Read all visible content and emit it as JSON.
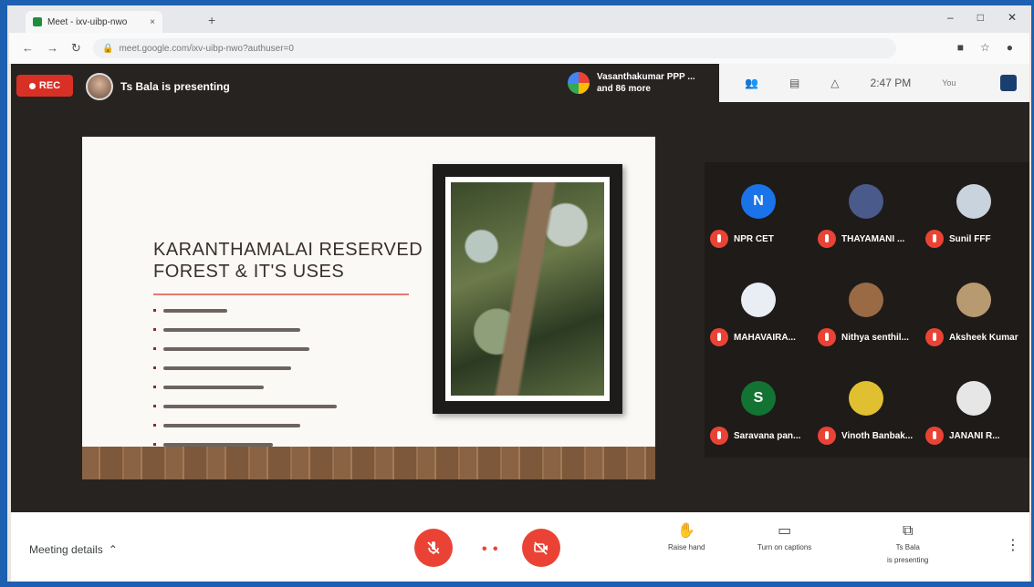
{
  "browser": {
    "tab_title": "Meet - ixv-uibp-nwo",
    "new_tab_symbol": "+",
    "close_tab_symbol": "×",
    "url": "meet.google.com/ixv-uibp-nwo?authuser=0",
    "window_controls": [
      "–",
      "□",
      "✕"
    ]
  },
  "meeting": {
    "rec_label": "REC",
    "presenter_text": "Ts Bala is presenting",
    "others_line1": "Vasanthakumar PPP ...",
    "others_line2": "and 86 more",
    "top_right": {
      "icons": [
        "participants-icon",
        "chat-icon",
        "activities-icon"
      ],
      "time": "2:47 PM",
      "you_label": "You"
    }
  },
  "slide": {
    "title": "KARANTHAMALAI RESERVED FOREST & IT'S USES",
    "bullet_widths": [
      70,
      150,
      160,
      140,
      110,
      190,
      150,
      120
    ],
    "accent_color": "#e07a72"
  },
  "participants": [
    {
      "name": "NPR CET",
      "initial": "N",
      "color": "#1a73e8"
    },
    {
      "name": "THAYAMANI ...",
      "initial": "",
      "color": "#4a5a8a"
    },
    {
      "name": "Sunil FFF",
      "initial": "",
      "color": "#c9d3de"
    },
    {
      "name": "MAHAVAIRA...",
      "initial": "",
      "color": "#e8eef4"
    },
    {
      "name": "Nithya senthil...",
      "initial": "",
      "color": "#9a6a44"
    },
    {
      "name": "Aksheek Kumar",
      "initial": "",
      "color": "#b89a70"
    },
    {
      "name": "Saravana pan...",
      "initial": "S",
      "color": "#137333"
    },
    {
      "name": "Vinoth Banbak...",
      "initial": "",
      "color": "#e0c030"
    },
    {
      "name": "JANANI R...",
      "initial": "",
      "color": "#e6e6e6"
    }
  ],
  "bottom_bar": {
    "meeting_details": "Meeting details",
    "raise_hand": "Raise hand",
    "turn_on_captions": "Turn on captions",
    "presenting_line1": "Ts Bala",
    "presenting_line2": "is presenting",
    "more_symbol": "⋮"
  },
  "colors": {
    "stage_bg": "#272320",
    "danger": "#ea4335",
    "rec": "#d93025"
  }
}
